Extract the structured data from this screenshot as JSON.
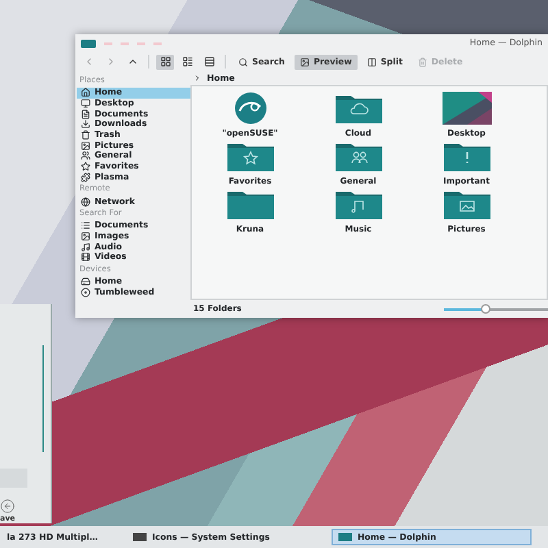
{
  "dolphin": {
    "title": "Home — Dolphin",
    "nav": [
      {
        "kind": "back",
        "disabled": true
      },
      {
        "kind": "forward",
        "disabled": true
      },
      {
        "kind": "up",
        "disabled": false
      }
    ],
    "view_modes": [
      {
        "kind": "icons",
        "selected": true
      },
      {
        "kind": "compact",
        "selected": false
      },
      {
        "kind": "details",
        "selected": false
      }
    ],
    "actions": [
      {
        "kind": "search",
        "label": "Search",
        "selected": false,
        "disabled": false
      },
      {
        "kind": "preview",
        "label": "Preview",
        "selected": true,
        "disabled": false
      },
      {
        "kind": "split",
        "label": "Split",
        "selected": false,
        "disabled": false
      },
      {
        "kind": "delete",
        "label": "Delete",
        "selected": false,
        "disabled": true
      }
    ],
    "sidebar": [
      {
        "heading": "Places",
        "items": [
          {
            "kind": "home",
            "label": "Home",
            "selected": true
          },
          {
            "kind": "desktop",
            "label": "Desktop",
            "selected": false
          },
          {
            "kind": "documents",
            "label": "Documents",
            "selected": false
          },
          {
            "kind": "downloads",
            "label": "Downloads",
            "selected": false
          },
          {
            "kind": "trash",
            "label": "Trash",
            "selected": false
          },
          {
            "kind": "pictures",
            "label": "Pictures",
            "selected": false
          },
          {
            "kind": "group",
            "label": "General",
            "selected": false
          },
          {
            "kind": "star",
            "label": "Favorites",
            "selected": false
          },
          {
            "kind": "plasma",
            "label": "Plasma",
            "selected": false
          }
        ]
      },
      {
        "heading": "Remote",
        "items": [
          {
            "kind": "network",
            "label": "Network",
            "selected": false
          }
        ]
      },
      {
        "heading": "Search For",
        "items": [
          {
            "kind": "list",
            "label": "Documents",
            "selected": false
          },
          {
            "kind": "pictures",
            "label": "Images",
            "selected": false
          },
          {
            "kind": "audio",
            "label": "Audio",
            "selected": false
          },
          {
            "kind": "video",
            "label": "Videos",
            "selected": false
          }
        ]
      },
      {
        "heading": "Devices",
        "items": [
          {
            "kind": "drive",
            "label": "Home",
            "selected": false
          },
          {
            "kind": "disk",
            "label": "Tumbleweed",
            "selected": false
          }
        ]
      }
    ],
    "breadcrumb": [
      "Home"
    ],
    "folders": [
      {
        "kind": "logo",
        "label": "\"openSUSE\""
      },
      {
        "kind": "cloud",
        "label": "Cloud"
      },
      {
        "kind": "wallpaper",
        "label": "Desktop"
      },
      {
        "kind": "star",
        "label": "Favorites"
      },
      {
        "kind": "group",
        "label": "General"
      },
      {
        "kind": "important",
        "label": "Important"
      },
      {
        "kind": "plain",
        "label": "Kruna"
      },
      {
        "kind": "music",
        "label": "Music"
      },
      {
        "kind": "pictures",
        "label": "Pictures"
      }
    ],
    "status": "15 Folders",
    "zoom": {
      "level": 0.38
    }
  },
  "side_window": {
    "label": "ave"
  },
  "taskbar": [
    {
      "label": "la 273 HD Multipl…",
      "kind": "plain",
      "selected": false
    },
    {
      "label": "Icons — System Settings",
      "kind": "settings",
      "selected": false
    },
    {
      "label": "Home — Dolphin",
      "kind": "folder",
      "selected": true
    }
  ]
}
